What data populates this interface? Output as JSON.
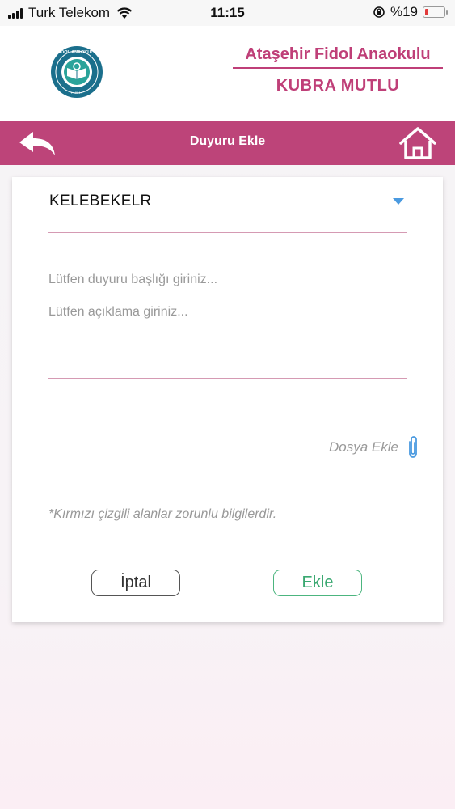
{
  "status_bar": {
    "carrier": "Turk Telekom",
    "time": "11:15",
    "battery": "%19",
    "battery_level": 0.19,
    "battery_color": "#e23b3b"
  },
  "header": {
    "logo_icon": "fidol-anaokulu-logo",
    "school_name": "Ataşehir Fidol Anaokulu",
    "user_name": "KUBRA MUTLU",
    "accent_color": "#bf3f78"
  },
  "navbar": {
    "title": "Duyuru Ekle",
    "back_icon": "back-arrow-icon",
    "home_icon": "home-icon",
    "background": "#bd4479"
  },
  "form": {
    "class_select": "KELEBEKELR",
    "title_placeholder": "Lütfen duyuru başlığı giriniz...",
    "description_placeholder": "Lütfen açıklama giriniz...",
    "attach_label": "Dosya Ekle",
    "attach_icon": "paperclip-icon",
    "required_note": "*Kırmızı çizgili alanlar zorunlu bilgilerdir.",
    "cancel_label": "İptal",
    "add_label": "Ekle"
  }
}
